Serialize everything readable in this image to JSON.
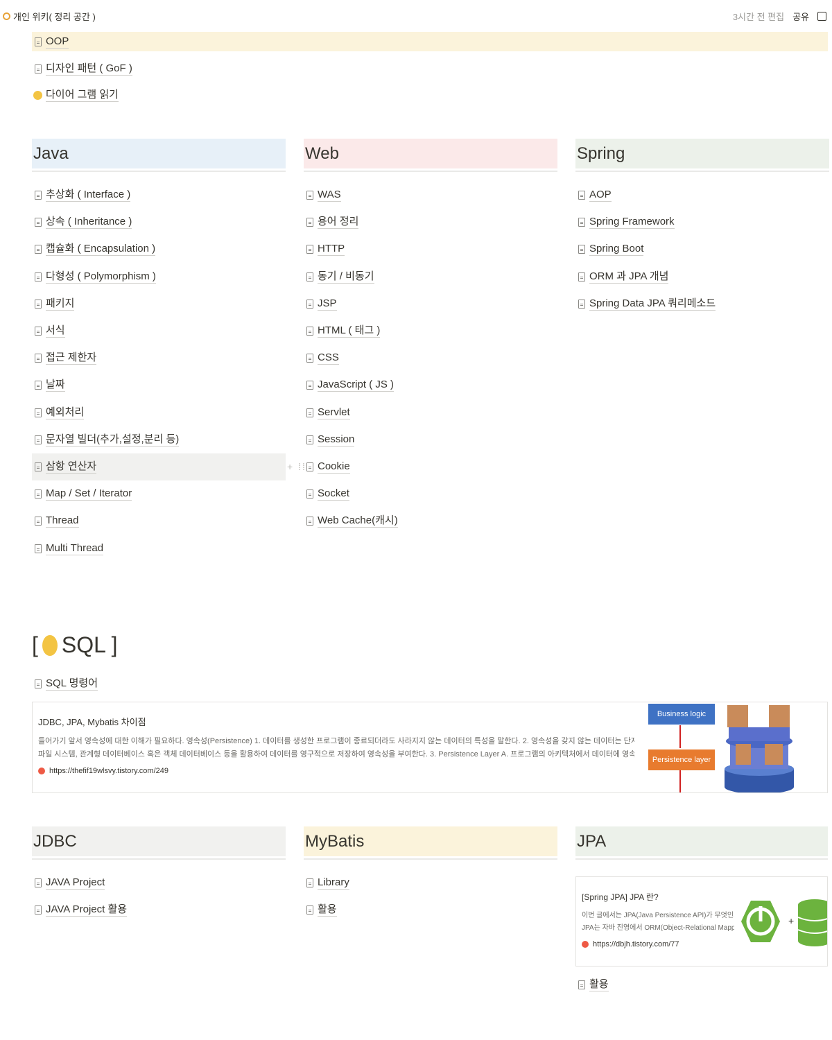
{
  "header": {
    "breadcrumb": "개인 위키( 정리 공간 )",
    "edited": "3시간 전 편집",
    "share": "공유"
  },
  "top_pages": [
    {
      "label": "OOP",
      "icon": "page-icon",
      "highlighted": true
    },
    {
      "label": "디자인 패턴 ( GoF )",
      "icon": "page-icon"
    },
    {
      "label": "다이어 그램 읽기",
      "icon": "emoji-face-icon"
    }
  ],
  "columns": [
    {
      "title": "Java",
      "color": "#e7f0f8",
      "items": [
        "추상화 ( Interface )",
        "상속 ( Inheritance )",
        "캡슐화 ( Encapsulation )",
        "다형성 ( Polymorphism )",
        "패키지",
        "서식",
        "접근 제한자",
        "날짜",
        "예외처리",
        "문자열 빌더(추가,설정,분리 등)",
        "삼항 연산자",
        "Map / Set / Iterator",
        "Thread",
        "Multi Thread"
      ]
    },
    {
      "title": "Web",
      "color": "#fbe9e9",
      "items": [
        "WAS",
        "용어 정리",
        "HTTP",
        "동기 / 비동기",
        "JSP",
        "HTML ( 태그 )",
        "CSS",
        "JavaScript ( JS )",
        "Servlet",
        "Session",
        "Cookie",
        "Socket",
        "Web Cache(캐시)"
      ]
    },
    {
      "title": "Spring",
      "color": "#ecf1ea",
      "items": [
        "AOP",
        "Spring Framework",
        "Spring Boot",
        "ORM 과 JPA 개념",
        "Spring Data JPA 쿼리메소드"
      ]
    }
  ],
  "sql": {
    "heading_open": "[",
    "heading_text": "SQL ]",
    "page": "SQL 명령어",
    "bookmark": {
      "title": "JDBC, JPA, Mybatis 차이점",
      "desc1": "들어가기 앞서 영속성에 대한 이해가 필요하다. 영속성(Persistence) 1. 데이터를 생성한 프로그램이 종료되더라도 사라지지 않는 데이터의 특성을 말한다. 2. 영속성을 갖지 않는 데이터는 단지 메모리에서만 존재하기 때문에 프로그램이 종료되면 모두 잃어버리게 된다. 때문에",
      "desc2": "파일 시스템, 관계형 데이터베이스 혹은 객체 데이터베이스 등을 활용하여 데이터를 영구적으로 저장하여 영속성을 부여한다. 3. Persistence Layer A. 프로그램의 아키텍처에서 데이터에 영속성을 부여해주는 계층을 말한다. B. JDBC를 이용하여 직접 구현할 수 있지만",
      "url": "https://thefif19wlsvy.tistory.com/249",
      "image_label_top": "Business logic",
      "image_label_bottom": "Persistence layer"
    }
  },
  "bottom_columns": [
    {
      "title": "JDBC",
      "color": "#f1f1ef",
      "items": [
        "JAVA Project",
        "JAVA Project 활용"
      ]
    },
    {
      "title": "MyBatis",
      "color": "#fbf3db",
      "items": [
        "Library",
        "활용"
      ]
    },
    {
      "title": "JPA",
      "color": "#ecf1ea",
      "items": [
        "활용"
      ]
    }
  ],
  "jpa_bookmark": {
    "title": "[Spring JPA] JPA 란?",
    "desc1": "이번 글에서는 JPA(Java Persistence API)가 무엇인지 알아보려고한다.",
    "desc2": "JPA는 자바 진영에서 ORM(Object-Relational Mapping) 기술 표준으",
    "url": "https://dbjh.tistory.com/77",
    "plus": "+"
  }
}
